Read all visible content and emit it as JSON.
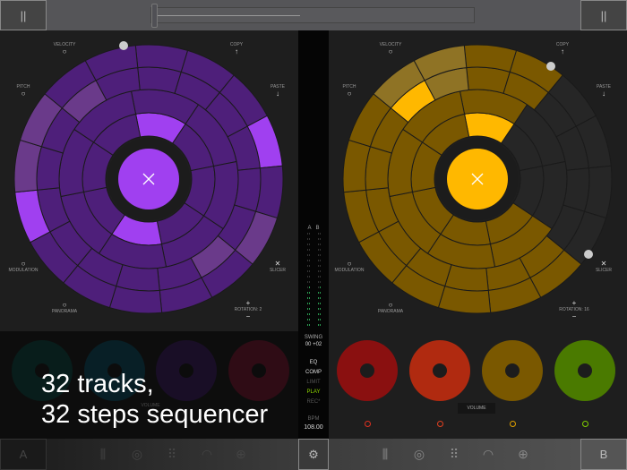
{
  "top": {
    "left_btn": "||",
    "right_btn": "||",
    "slider_value": 0.45
  },
  "labels": {
    "velocity": "VELOCITY",
    "copy": "COPY",
    "pitch": "PITCH",
    "paste": "PASTE",
    "modulation": "MODULATION",
    "slicer": "SLICER",
    "panorama": "PANORAMA"
  },
  "deckA": {
    "rotation": "ROTATION: 2",
    "color": "#4e1f7a",
    "accent": "#a040f0"
  },
  "deckB": {
    "rotation": "ROTATION: 16",
    "color": "#7a5800",
    "accent": "#ffb800"
  },
  "mixer": {
    "a": "A",
    "b": "B",
    "swing_label": "SWING",
    "swing_a": "00",
    "swing_b": "+02",
    "eq": "EQ",
    "comp": "COMP",
    "limit": "LIMIT",
    "play": "PLAY",
    "rec": "REC*",
    "bpm_label": "BPM",
    "bpm": "108.00"
  },
  "volume_label": "VOLUME",
  "promo": {
    "line1": "32 tracks,",
    "line2": "32 steps sequencer"
  },
  "bottom": {
    "a": "A",
    "b": "B"
  },
  "mini_colors": [
    "#0a5a50",
    "#0a5f7a",
    "#4a1f7a",
    "#9a1a3a",
    "#8a1010",
    "#b02a10",
    "#7a5800",
    "#4a7a00"
  ]
}
